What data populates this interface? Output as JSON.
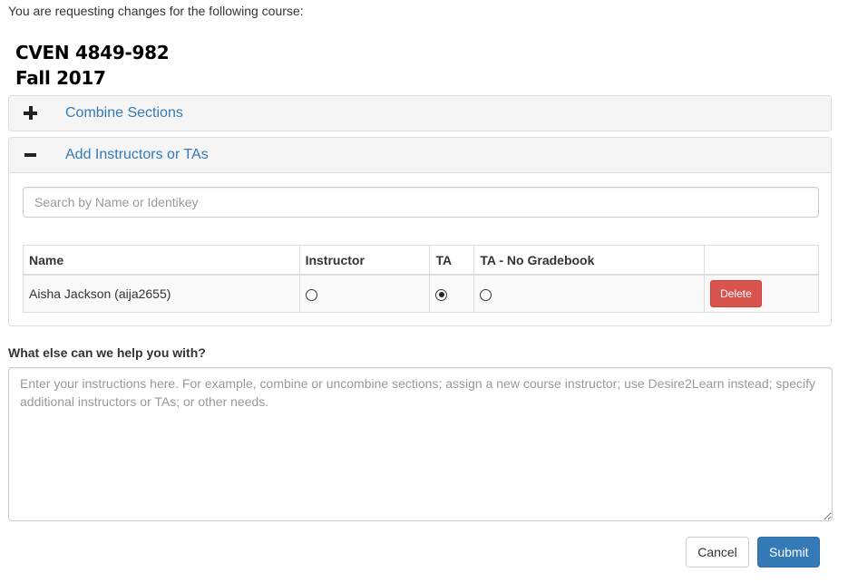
{
  "intro_text": "You are requesting changes for the following course:",
  "course": {
    "code": "CVEN 4849-982",
    "term": "Fall 2017"
  },
  "panels": {
    "combine": {
      "title": "Combine Sections",
      "icon": "plus-icon",
      "expanded": false
    },
    "add_instructors": {
      "title": "Add Instructors or TAs",
      "icon": "minus-icon",
      "expanded": true,
      "search_placeholder": "Search by Name or Identikey",
      "table": {
        "headers": [
          "Name",
          "Instructor",
          "TA",
          "TA - No Gradebook",
          ""
        ],
        "rows": [
          {
            "name": "Aisha Jackson (aija2655)",
            "role": "TA",
            "delete_label": "Delete"
          }
        ]
      }
    }
  },
  "help": {
    "label": "What else can we help you with?",
    "placeholder": "Enter your instructions here. For example, combine or uncombine sections; assign a new course instructor; use Desire2Learn instead; specify additional instructors or TAs; or other needs."
  },
  "actions": {
    "cancel_label": "Cancel",
    "submit_label": "Submit"
  },
  "colors": {
    "link": "#337ab7",
    "danger": "#d9534f",
    "primary": "#337ab7"
  }
}
